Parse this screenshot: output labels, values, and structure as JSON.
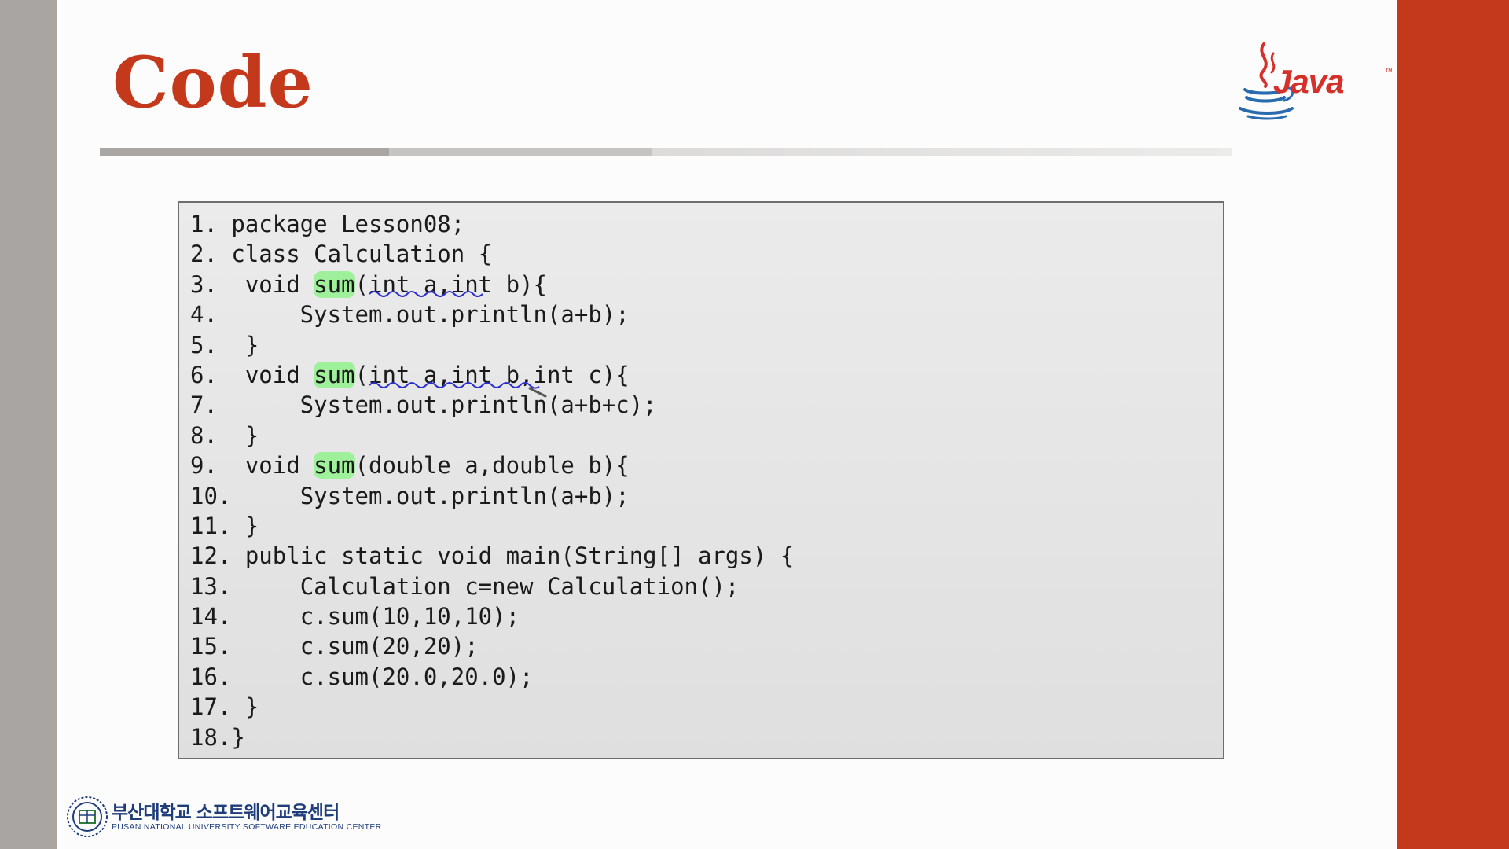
{
  "slide": {
    "title": "Code",
    "accent_color": "#c4391c",
    "logo": {
      "icon": "java-coffee-cup-icon",
      "text": "Java",
      "tm": "™"
    }
  },
  "code": {
    "lines": [
      {
        "num": "1.",
        "pre": " package Lesson08;",
        "hl": "",
        "post": ""
      },
      {
        "num": "2.",
        "pre": " class Calculation {",
        "hl": "",
        "post": ""
      },
      {
        "num": "3.",
        "pre": "  void ",
        "hl": "sum",
        "post": "(int a,int b){"
      },
      {
        "num": "4.",
        "pre": "      System.out.println(a+b);",
        "hl": "",
        "post": ""
      },
      {
        "num": "5.",
        "pre": "  }",
        "hl": "",
        "post": ""
      },
      {
        "num": "6.",
        "pre": "  void ",
        "hl": "sum",
        "post": "(int a,int b,int c){"
      },
      {
        "num": "7.",
        "pre": "      System.out.println(a+b+c);",
        "hl": "",
        "post": ""
      },
      {
        "num": "8.",
        "pre": "  }",
        "hl": "",
        "post": ""
      },
      {
        "num": "9.",
        "pre": "  void ",
        "hl": "sum",
        "post": "(double a,double b){"
      },
      {
        "num": "10.",
        "pre": "     System.out.println(a+b);",
        "hl": "",
        "post": ""
      },
      {
        "num": "11.",
        "pre": " }",
        "hl": "",
        "post": ""
      },
      {
        "num": "12.",
        "pre": " public static void main(String[] args) {",
        "hl": "",
        "post": ""
      },
      {
        "num": "13.",
        "pre": "     Calculation c=new Calculation();",
        "hl": "",
        "post": ""
      },
      {
        "num": "14.",
        "pre": "     c.sum(10,10,10);",
        "hl": "",
        "post": ""
      },
      {
        "num": "15.",
        "pre": "     c.sum(20,20);",
        "hl": "",
        "post": ""
      },
      {
        "num": "16.",
        "pre": "     c.sum(20.0,20.0);",
        "hl": "",
        "post": ""
      },
      {
        "num": "17.",
        "pre": " }",
        "hl": "",
        "post": ""
      },
      {
        "num": "18.",
        "pre": "}",
        "hl": "",
        "post": ""
      }
    ],
    "highlight_color": "#9ef09a",
    "annotation_color": "#2a2fd0"
  },
  "footer": {
    "org_name_kr": "부산대학교 소프트웨어교육센터",
    "org_name_en": "PUSAN NATIONAL UNIVERSITY SOFTWARE EDUCATION CENTER",
    "emblem_icon": "university-emblem-icon"
  }
}
